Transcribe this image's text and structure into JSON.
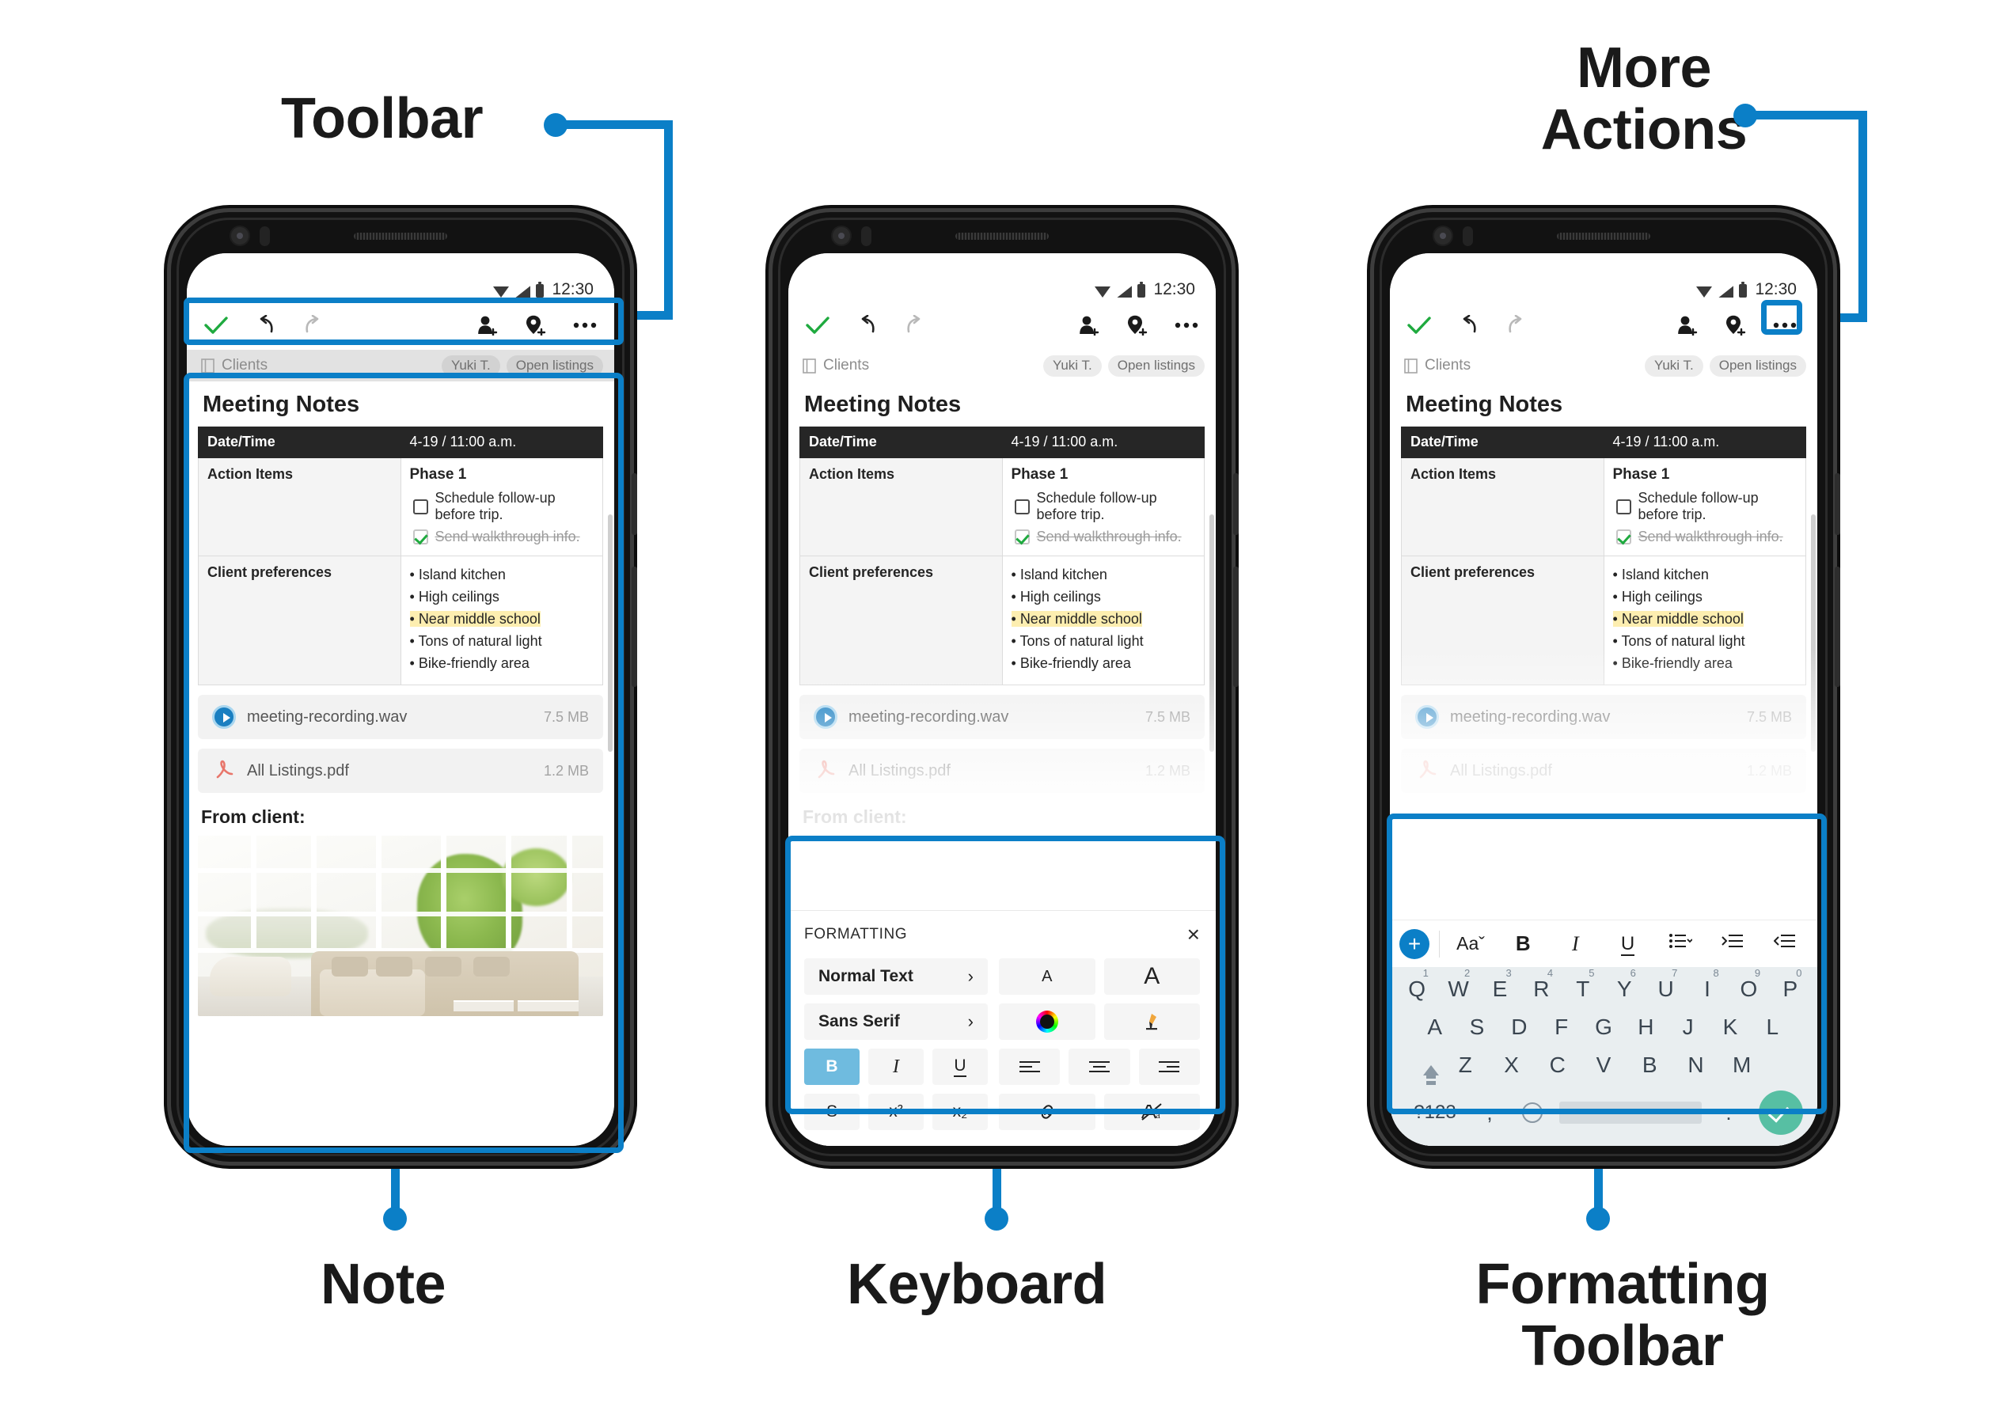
{
  "accent_color": "#0b7fc7",
  "callouts": [
    {
      "key": "toolbar",
      "label": "Toolbar"
    },
    {
      "key": "more",
      "label": "More\nActions",
      "line1": "More",
      "line2": "Actions"
    },
    {
      "key": "note",
      "label": "Note"
    },
    {
      "key": "keyboard",
      "label": "Keyboard"
    },
    {
      "key": "formatting",
      "line1": "Formatting",
      "line2": "Toolbar"
    }
  ],
  "status_bar": {
    "time": "12:30",
    "icons": [
      "wifi-icon",
      "cellular-signal-icon",
      "battery-icon"
    ]
  },
  "toolbar": {
    "done_label": "done-check",
    "icons": [
      "check-icon",
      "undo-icon",
      "redo-icon",
      "add-person-icon",
      "add-location-icon",
      "more-actions-icon"
    ]
  },
  "breadcrumb": {
    "icon": "notebook-icon",
    "label": "Clients",
    "chips": [
      "Yuki T.",
      "Open listings"
    ]
  },
  "note": {
    "title": "Meeting Notes",
    "table": {
      "header": {
        "label": "Date/Time",
        "value": "4-19 / 11:00 a.m."
      },
      "rows": [
        {
          "label": "Action Items",
          "heading": "Phase 1",
          "checklist": [
            {
              "text": "Schedule follow-up before trip.",
              "checked": false
            },
            {
              "text": "Send walkthrough info.",
              "checked": true
            }
          ]
        },
        {
          "label": "Client preferences",
          "bullets": [
            {
              "text": "Island kitchen",
              "highlighted": false
            },
            {
              "text": "High ceilings",
              "highlighted": false
            },
            {
              "text": "Near middle school",
              "highlighted": true
            },
            {
              "text": "Tons of natural light",
              "highlighted": false
            },
            {
              "text": "Bike-friendly area",
              "highlighted": false
            }
          ],
          "highlight_color": "#fdeeb0"
        }
      ]
    },
    "attachments": [
      {
        "icon": "play-audio-icon",
        "name": "meeting-recording.wav",
        "size": "7.5 MB"
      },
      {
        "icon": "pdf-icon",
        "name": "All Listings.pdf",
        "size": "1.2 MB"
      }
    ],
    "from_client_label": "From client:",
    "image_alt": "living-room-photo"
  },
  "formatting_panel": {
    "title": "FORMATTING",
    "close_label": "×",
    "style_select": {
      "label": "Normal Text",
      "chevron": "›"
    },
    "font_select": {
      "label": "Sans Serif",
      "chevron": "›"
    },
    "size_buttons": [
      {
        "icon": "decrease-font-size-icon",
        "label": "A"
      },
      {
        "icon": "increase-font-size-icon",
        "label": "A"
      }
    ],
    "color_button": {
      "icon": "text-color-wheel-icon"
    },
    "highlight_button": {
      "icon": "highlighter-icon"
    },
    "style_row": [
      {
        "icon": "bold-icon",
        "label": "B",
        "active": true
      },
      {
        "icon": "italic-icon",
        "label": "I",
        "active": false
      },
      {
        "icon": "underline-icon",
        "label": "U",
        "active": false
      }
    ],
    "align_row": [
      {
        "icon": "align-left-icon"
      },
      {
        "icon": "align-center-icon"
      },
      {
        "icon": "align-right-icon"
      }
    ],
    "extra_row": [
      {
        "icon": "strikethrough-icon",
        "label": "S"
      },
      {
        "icon": "superscript-icon",
        "label": "x²"
      },
      {
        "icon": "subscript-icon",
        "label": "x₂"
      }
    ],
    "link_button": {
      "icon": "link-icon"
    },
    "clear_format_button": {
      "icon": "clear-formatting-icon"
    }
  },
  "formatting_toolbar": {
    "add_button": {
      "icon": "plus-icon",
      "label": "+"
    },
    "items": [
      {
        "icon": "text-style-icon",
        "label": "Aaˇ"
      },
      {
        "icon": "bold-icon",
        "label": "B"
      },
      {
        "icon": "italic-icon",
        "label": "I"
      },
      {
        "icon": "underline-icon",
        "label": "U"
      },
      {
        "icon": "bulleted-list-icon",
        "label": ""
      },
      {
        "icon": "increase-indent-icon",
        "label": ""
      },
      {
        "icon": "decrease-indent-icon",
        "label": ""
      }
    ]
  },
  "keyboard": {
    "row1": [
      {
        "key": "Q",
        "num": "1"
      },
      {
        "key": "W",
        "num": "2"
      },
      {
        "key": "E",
        "num": "3"
      },
      {
        "key": "R",
        "num": "4"
      },
      {
        "key": "T",
        "num": "5"
      },
      {
        "key": "Y",
        "num": "6"
      },
      {
        "key": "U",
        "num": "7"
      },
      {
        "key": "I",
        "num": "8"
      },
      {
        "key": "O",
        "num": "9"
      },
      {
        "key": "P",
        "num": "0"
      }
    ],
    "row2": [
      "A",
      "S",
      "D",
      "F",
      "G",
      "H",
      "J",
      "K",
      "L"
    ],
    "row3_letters": [
      "Z",
      "X",
      "C",
      "V",
      "B",
      "N",
      "M"
    ],
    "shift_icon": "shift-icon",
    "delete_icon": "backspace-icon",
    "symbols_key": "?123",
    "comma_key": ",",
    "mic_icon": "microphone-icon",
    "space_key": "",
    "period_key": ".",
    "enter_icon": "enter-check-icon"
  }
}
